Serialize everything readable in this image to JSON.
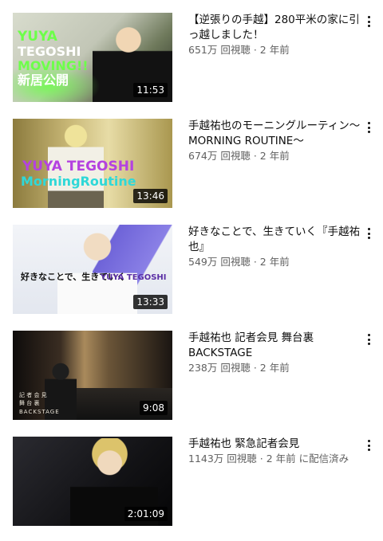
{
  "videos": [
    {
      "title": "【逆張りの手越】280平米の家に引っ越しました！",
      "views": "651万 回視聴",
      "age": "2 年前",
      "extra": "",
      "duration": "11:53",
      "thumb_lines": [
        "YUYA",
        "TEGOSHI",
        "MOVING!!",
        "新居公開"
      ],
      "colors": {
        "bg": "#cfd3c3",
        "accent": "#6dff4a"
      }
    },
    {
      "title": "手越祐也のモーニングルーティン〜MORNING ROUTINE〜",
      "views": "674万 回視聴",
      "age": "2 年前",
      "extra": "",
      "duration": "13:46",
      "thumb_lines": [
        "YUYA TEGOSHI",
        "MorningRoutine"
      ],
      "colors": {
        "bg": "#b7a869",
        "accent": "#b442e0",
        "accent2": "#2fd8d8"
      }
    },
    {
      "title": "好きなことで、生きていく『手越祐也』",
      "views": "549万 回視聴",
      "age": "2 年前",
      "extra": "",
      "duration": "13:33",
      "thumb_lines": [
        "好きなことで、生きていく",
        "YUYA TEGOSHI"
      ],
      "colors": {
        "bg": "#e9ecf3",
        "accent": "#6e63d8"
      }
    },
    {
      "title": "手越祐也 記者会見 舞台裏 BACKSTAGE",
      "views": "238万 回視聴",
      "age": "2 年前",
      "extra": "",
      "duration": "9:08",
      "thumb_lines": [
        "記 者 会 見",
        "舞 台 裏",
        "BACKSTAGE"
      ],
      "colors": {
        "bg": "#2a2420",
        "accent": "#c9a36a"
      }
    },
    {
      "title": "手越祐也 緊急記者会見",
      "views": "1143万 回視聴",
      "age": "2 年前",
      "extra": "に配信済み",
      "duration": "2:01:09",
      "thumb_lines": [],
      "colors": {
        "bg": "#1b1b1f",
        "accent": "#d9c06a"
      }
    }
  ],
  "separator": "·",
  "icons": {
    "more": "more-vert-icon"
  }
}
